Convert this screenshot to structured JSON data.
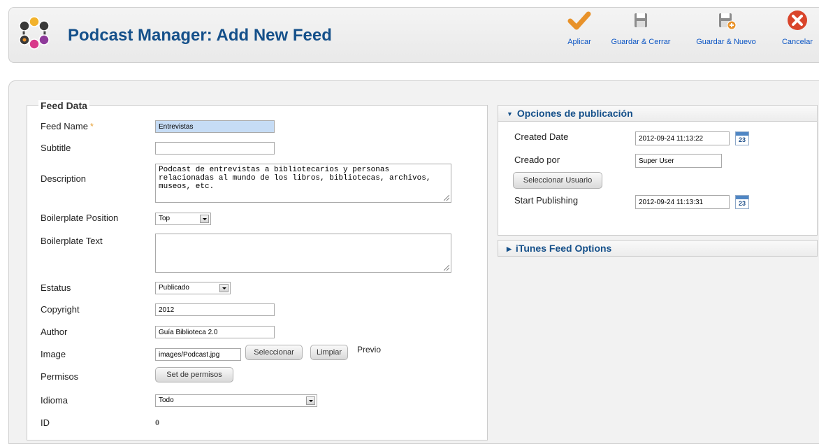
{
  "header": {
    "title": "Podcast Manager: Add New Feed",
    "logo_icon": "podcast-logo-icon"
  },
  "toolbar": {
    "apply_label": "Aplicar",
    "save_close_label": "Guardar & Cerrar",
    "save_new_label": "Guardar & Nuevo",
    "cancel_label": "Cancelar"
  },
  "feed_data": {
    "legend": "Feed Data",
    "feed_name_label": "Feed Name",
    "required_marker": "*",
    "feed_name_value": "Entrevistas",
    "subtitle_label": "Subtitle",
    "subtitle_value": "",
    "description_label": "Description",
    "description_value": "Podcast de entrevistas a bibliotecarios y personas relacionadas al mundo de los libros, bibliotecas, archivos, museos, etc.",
    "boilerplate_position_label": "Boilerplate Position",
    "boilerplate_position_value": "Top",
    "boilerplate_text_label": "Boilerplate Text",
    "boilerplate_text_value": "",
    "estatus_label": "Estatus",
    "estatus_value": "Publicado",
    "copyright_label": "Copyright",
    "copyright_value": "2012",
    "author_label": "Author",
    "author_value": "Guía Biblioteca 2.0",
    "image_label": "Image",
    "image_value": "images/Podcast.jpg",
    "select_button": "Seleccionar",
    "clear_button": "Limpiar",
    "preview_label": "Previo",
    "permisos_label": "Permisos",
    "permisos_button": "Set de permisos",
    "idioma_label": "Idioma",
    "idioma_value": "Todo",
    "id_label": "ID",
    "id_value": "0"
  },
  "publishing": {
    "header": "Opciones de publicación",
    "created_date_label": "Created Date",
    "created_date_value": "2012-09-24 11:13:22",
    "created_by_label": "Creado por",
    "created_by_value": "Super User",
    "select_user_button": "Seleccionar Usuario",
    "start_publishing_label": "Start Publishing",
    "start_publishing_value": "2012-09-24 11:13:31",
    "calendar_day": "23"
  },
  "itunes": {
    "header": "iTunes Feed Options"
  },
  "colors": {
    "title_blue": "#15508a",
    "toolbar_link": "#0b55c4",
    "apply_orange": "#e8922a",
    "cancel_red": "#d9452b",
    "highlight_field": "#c6dcf5"
  }
}
